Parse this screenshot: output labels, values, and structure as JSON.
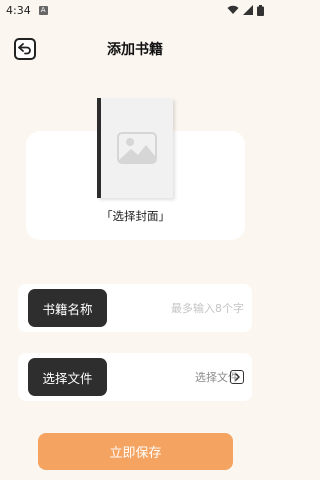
{
  "status_bar": {
    "time": "4:34",
    "notification_icon": "a-notification-icon",
    "icons": [
      "wifi-icon",
      "signal-icon",
      "battery-icon"
    ]
  },
  "header": {
    "title": "添加书籍",
    "back_icon": "return-arrow-icon"
  },
  "cover": {
    "label": "「选择封面」",
    "placeholder_icon": "image-placeholder-icon"
  },
  "form": {
    "name": {
      "label": "书籍名称",
      "placeholder": "最多输入8个字",
      "value": ""
    },
    "file": {
      "label": "选择文件",
      "value": "选择文件",
      "icon": "chevron-right-box-icon"
    }
  },
  "actions": {
    "save_label": "立即保存"
  },
  "colors": {
    "background": "#FBF6F0",
    "accent": "#F4A361",
    "label_pill": "#2E2E2E"
  }
}
